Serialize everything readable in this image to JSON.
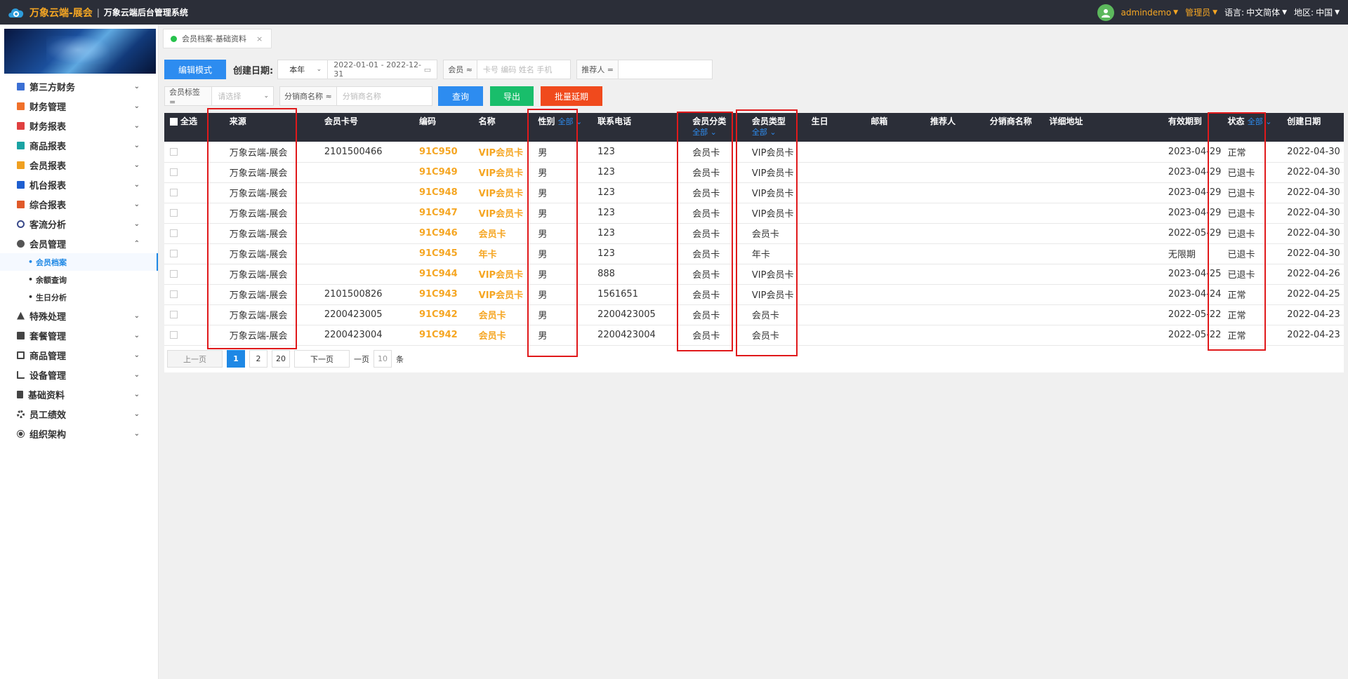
{
  "header": {
    "brand": "万象云端-展会",
    "separator": "|",
    "subtitle": "万象云端后台管理系统",
    "user": "admindemo",
    "role": "管理员",
    "language_label": "语言:",
    "language_value": "中文简体",
    "region_label": "地区:",
    "region_value": "中国"
  },
  "sidebar": {
    "items": [
      {
        "label": "第三方财务",
        "icon_color": "#3b6fd4"
      },
      {
        "label": "财务管理",
        "icon_color": "#f0702a"
      },
      {
        "label": "财务报表",
        "icon_color": "#e04040"
      },
      {
        "label": "商品报表",
        "icon_color": "#1aa3a3"
      },
      {
        "label": "会员报表",
        "icon_color": "#f0a020"
      },
      {
        "label": "机台报表",
        "icon_color": "#1e5fd0"
      },
      {
        "label": "综合报表",
        "icon_color": "#e05a2a"
      },
      {
        "label": "客流分析",
        "icon_color": "#3a4a8a"
      },
      {
        "label": "会员管理",
        "icon_color": "#555555"
      }
    ],
    "subitems": [
      "会员档案",
      "余额查询",
      "生日分析"
    ],
    "items_after": [
      {
        "label": "特殊处理",
        "icon_color": "#444444"
      },
      {
        "label": "套餐管理",
        "icon_color": "#444444"
      },
      {
        "label": "商品管理",
        "icon_color": "#444444"
      },
      {
        "label": "设备管理",
        "icon_color": "#444444"
      },
      {
        "label": "基础资料",
        "icon_color": "#444444"
      },
      {
        "label": "员工绩效",
        "icon_color": "#444444"
      },
      {
        "label": "组织架构",
        "icon_color": "#444444"
      }
    ]
  },
  "tab": {
    "label": "会员档案-基础资料",
    "close": "×"
  },
  "toolbar": {
    "edit_mode": "编辑模式",
    "create_date_label": "创建日期:",
    "year_select": "本年",
    "date_range": "2022-01-01 - 2022-12-31",
    "member_prefix": "会员 ≈",
    "member_placeholder": "卡号 编码 姓名 手机",
    "referrer_prefix": "推荐人 =",
    "tag_prefix": "会员标签 =",
    "tag_placeholder": "请选择",
    "distributor_prefix": "分销商名称 ≈",
    "distributor_placeholder": "分销商名称",
    "query": "查询",
    "export": "导出",
    "batch_extend": "批量延期"
  },
  "table": {
    "headers": {
      "select_all": "全选",
      "source": "来源",
      "card_no": "会员卡号",
      "code": "编码",
      "name": "名称",
      "gender": "性别",
      "gender_filter": "全部",
      "phone": "联系电话",
      "category": "会员分类",
      "category_filter": "全部",
      "type": "会员类型",
      "type_filter": "全部",
      "birthday": "生日",
      "email": "邮箱",
      "referrer": "推荐人",
      "distributor": "分销商名称",
      "address": "详细地址",
      "expire": "有效期到",
      "status": "状态",
      "status_filter": "全部",
      "created": "创建日期"
    },
    "rows": [
      {
        "source": "万象云端-展会",
        "card_no": "2101500466",
        "code": "91C950",
        "name": "VIP会员卡",
        "gender": "男",
        "phone": "123",
        "category": "会员卡",
        "type": "VIP会员卡",
        "expire": "2023-04-29",
        "status": "正常",
        "created": "2022-04-30"
      },
      {
        "source": "万象云端-展会",
        "card_no": "",
        "code": "91C949",
        "name": "VIP会员卡",
        "gender": "男",
        "phone": "123",
        "category": "会员卡",
        "type": "VIP会员卡",
        "expire": "2023-04-29",
        "status": "已退卡",
        "created": "2022-04-30"
      },
      {
        "source": "万象云端-展会",
        "card_no": "",
        "code": "91C948",
        "name": "VIP会员卡",
        "gender": "男",
        "phone": "123",
        "category": "会员卡",
        "type": "VIP会员卡",
        "expire": "2023-04-29",
        "status": "已退卡",
        "created": "2022-04-30"
      },
      {
        "source": "万象云端-展会",
        "card_no": "",
        "code": "91C947",
        "name": "VIP会员卡",
        "gender": "男",
        "phone": "123",
        "category": "会员卡",
        "type": "VIP会员卡",
        "expire": "2023-04-29",
        "status": "已退卡",
        "created": "2022-04-30"
      },
      {
        "source": "万象云端-展会",
        "card_no": "",
        "code": "91C946",
        "name": "会员卡",
        "gender": "男",
        "phone": "123",
        "category": "会员卡",
        "type": "会员卡",
        "expire": "2022-05-29",
        "status": "已退卡",
        "created": "2022-04-30"
      },
      {
        "source": "万象云端-展会",
        "card_no": "",
        "code": "91C945",
        "name": "年卡",
        "gender": "男",
        "phone": "123",
        "category": "会员卡",
        "type": "年卡",
        "expire": "无限期",
        "status": "已退卡",
        "created": "2022-04-30"
      },
      {
        "source": "万象云端-展会",
        "card_no": "",
        "code": "91C944",
        "name": "VIP会员卡",
        "gender": "男",
        "phone": "888",
        "category": "会员卡",
        "type": "VIP会员卡",
        "expire": "2023-04-25",
        "status": "已退卡",
        "created": "2022-04-26"
      },
      {
        "source": "万象云端-展会",
        "card_no": "2101500826",
        "code": "91C943",
        "name": "VIP会员卡",
        "gender": "男",
        "phone": "1561651",
        "category": "会员卡",
        "type": "VIP会员卡",
        "expire": "2023-04-24",
        "status": "正常",
        "created": "2022-04-25"
      },
      {
        "source": "万象云端-展会",
        "card_no": "2200423005",
        "code": "91C942",
        "name": "会员卡",
        "gender": "男",
        "phone": "2200423005",
        "category": "会员卡",
        "type": "会员卡",
        "expire": "2022-05-22",
        "status": "正常",
        "created": "2022-04-23"
      },
      {
        "source": "万象云端-展会",
        "card_no": "2200423004",
        "code": "91C942",
        "name": "会员卡",
        "gender": "男",
        "phone": "2200423004",
        "category": "会员卡",
        "type": "会员卡",
        "expire": "2022-05-22",
        "status": "正常",
        "created": "2022-04-23"
      }
    ]
  },
  "pager": {
    "prev": "上一页",
    "pages": [
      "1",
      "2",
      "20"
    ],
    "next": "下一页",
    "per_page_label": "一页",
    "per_page": "10",
    "unit": "条"
  }
}
